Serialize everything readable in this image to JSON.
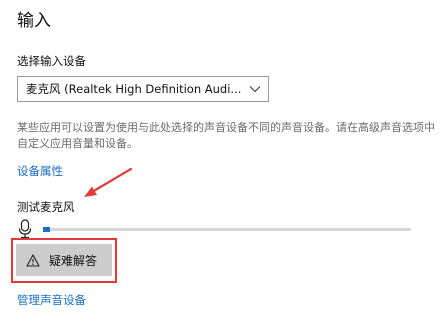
{
  "section": {
    "title": "输入"
  },
  "device": {
    "label": "选择输入设备",
    "selected": "麦克风 (Realtek High Definition Audi..."
  },
  "description": "某些应用可以设置为使用与此处选择的声音设备不同的声音设备。请在高级声音选项中自定义应用音量和设备。",
  "links": {
    "device_properties": "设备属性",
    "manage_devices": "管理声音设备"
  },
  "mic_test": {
    "label": "测试麦克风",
    "level_fraction": 0.02
  },
  "troubleshoot": {
    "label": "疑难解答"
  },
  "icons": {
    "dropdown": "chevron-down-icon",
    "microphone": "microphone-icon",
    "warning": "warning-icon"
  },
  "colors": {
    "accent": "#1a6fc4",
    "annotation": "#e23a3a",
    "button_bg": "#cccccc",
    "track": "#d8d8d8"
  }
}
